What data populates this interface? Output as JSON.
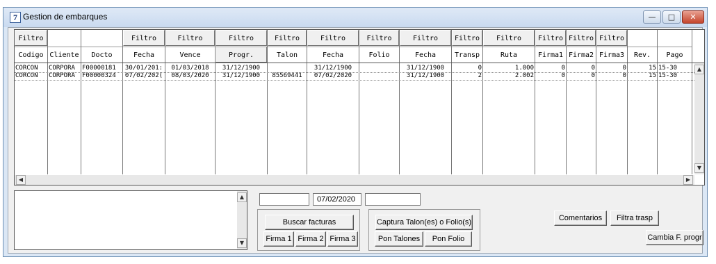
{
  "window": {
    "title": "Gestion de embarques",
    "app_icon_glyph": "7",
    "controls": {
      "minimize": "—",
      "maximize": "□",
      "close": "✕"
    }
  },
  "grid": {
    "filter_label": "Filtro",
    "columns": [
      {
        "label": "Codigo",
        "filter": true
      },
      {
        "label": "Cliente",
        "filter": false
      },
      {
        "label": "Docto",
        "filter": false
      },
      {
        "label": "Fecha",
        "filter": true
      },
      {
        "label": "Vence",
        "filter": true
      },
      {
        "label": "Progr.",
        "filter": true
      },
      {
        "label": "Talon",
        "filter": true
      },
      {
        "label": "Fecha",
        "filter": true
      },
      {
        "label": "Folio",
        "filter": true
      },
      {
        "label": "Fecha",
        "filter": true
      },
      {
        "label": "Transp",
        "filter": true
      },
      {
        "label": "Ruta",
        "filter": true
      },
      {
        "label": "Firma1",
        "filter": true
      },
      {
        "label": "Firma2",
        "filter": true
      },
      {
        "label": "Firma3",
        "filter": true
      },
      {
        "label": "Rev.",
        "filter": false
      },
      {
        "label": "Pago",
        "filter": false
      }
    ],
    "rows": [
      [
        "CORCON",
        "CORPORA",
        "F00000181",
        "30/01/201:",
        "01/03/2018",
        "31/12/1900",
        "",
        "31/12/1900",
        "",
        "31/12/1900",
        "0",
        "1.000",
        "0",
        "0",
        "0",
        "15",
        "15-30"
      ],
      [
        "CORCON",
        "CORPORA",
        "F00000324",
        "07/02/202(",
        "08/03/2020",
        "31/12/1900",
        "85569441",
        "07/02/2020",
        "",
        "31/12/1900",
        "2",
        "2.002",
        "0",
        "0",
        "0",
        "15",
        "15-30"
      ]
    ],
    "scroll": {
      "up": "▲",
      "down": "▼",
      "left": "◀",
      "right": "▶"
    }
  },
  "filters": {
    "field_left": "",
    "date_value": "07/02/2020",
    "field_right": ""
  },
  "buttons": {
    "buscar_facturas": "Buscar facturas",
    "firma1": "Firma 1",
    "firma2": "Firma 2",
    "firma3": "Firma 3",
    "captura_talones": "Captura Talon(es) o Folio(s)",
    "pon_talones": "Pon Talones",
    "pon_folio": "Pon Folio",
    "comentarios": "Comentarios",
    "filtra_trasp": "Filtra trasp",
    "cambia_f_progr": "Cambia F. progr"
  },
  "memo": {
    "value": ""
  }
}
